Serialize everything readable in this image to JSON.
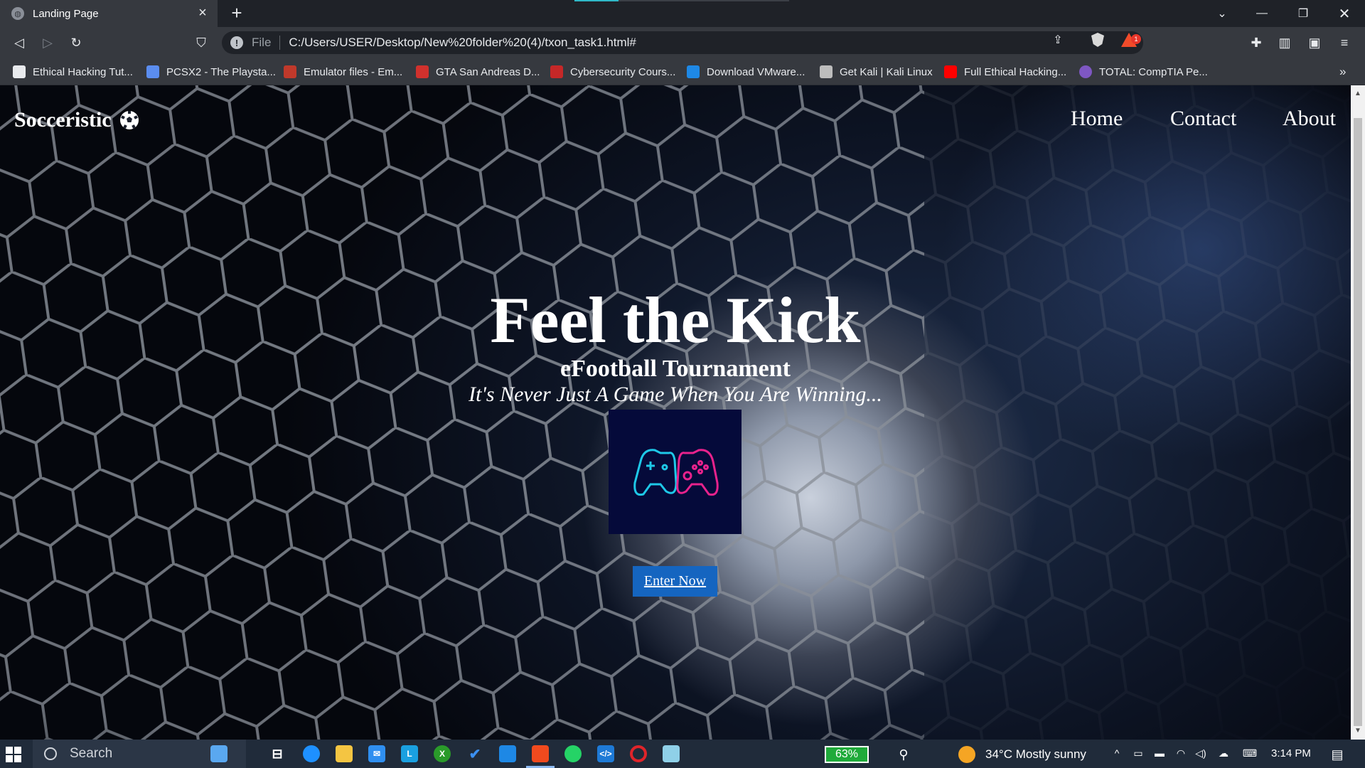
{
  "browser": {
    "tab_title": "Landing Page",
    "scheme_label": "File",
    "url": "C:/Users/USER/Desktop/New%20folder%20(4)/txon_task1.html#",
    "rewards_badge": "1",
    "bookmarks": [
      {
        "label": "Ethical Hacking Tut...",
        "color": "#e8eaed"
      },
      {
        "label": "PCSX2 - The Playsta...",
        "color": "#5b8def"
      },
      {
        "label": "Emulator files - Em...",
        "color": "#c0392b"
      },
      {
        "label": "GTA San Andreas D...",
        "color": "#d0312d"
      },
      {
        "label": "Cybersecurity Cours...",
        "color": "#c62828"
      },
      {
        "label": "Download VMware...",
        "color": "#1e88e5"
      },
      {
        "label": "Get Kali | Kali Linux",
        "color": "#bdbdbd"
      },
      {
        "label": "Full Ethical Hacking...",
        "color": "#ff0000"
      },
      {
        "label": "TOTAL: CompTIA Pe...",
        "color": "#7e57c2"
      }
    ]
  },
  "page": {
    "brand": "Socceristic",
    "nav": [
      "Home",
      "Contact",
      "About"
    ],
    "title": "Feel the Kick",
    "subtitle": "eFootball Tournament",
    "tagline": "It's Never Just A Game When You Are Winning...",
    "cta": "Enter Now",
    "cta_color": "#1565c0"
  },
  "taskbar": {
    "search_placeholder": "Search",
    "battery": "63%",
    "weather": "34°C  Mostly sunny",
    "time": "3:14 PM"
  }
}
